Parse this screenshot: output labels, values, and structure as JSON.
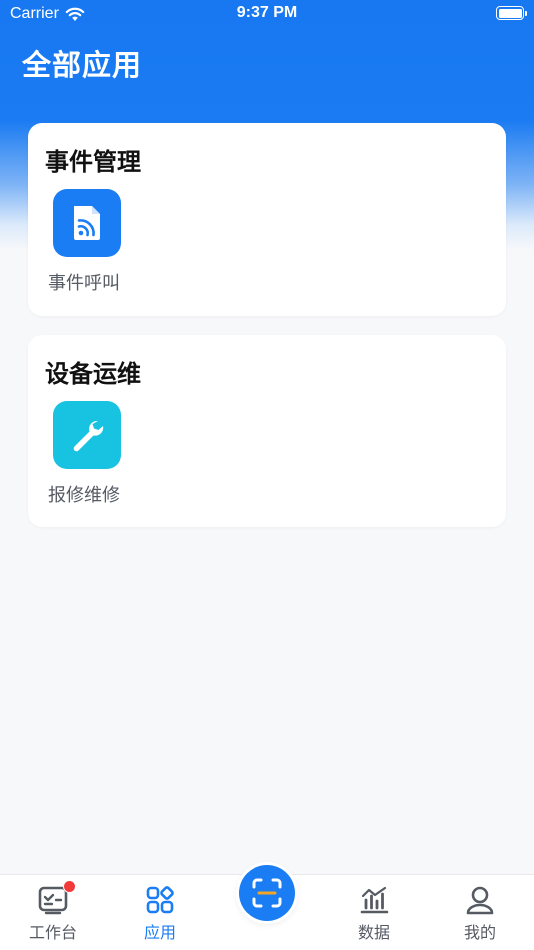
{
  "status_bar": {
    "carrier": "Carrier",
    "time": "9:37 PM",
    "wifi_icon": "wifi-icon",
    "battery_icon": "battery-full-icon",
    "battery_level": 1.0
  },
  "header": {
    "title": "全部应用"
  },
  "sections": [
    {
      "title": "事件管理",
      "apps": [
        {
          "label": "事件呼叫",
          "icon": "document-rss-icon",
          "color": "#1a7df4"
        }
      ]
    },
    {
      "title": "设备运维",
      "apps": [
        {
          "label": "报修维修",
          "icon": "wrench-icon",
          "color": "#18c3e2"
        }
      ]
    }
  ],
  "tabbar": {
    "items": [
      {
        "label": "工作台",
        "icon": "workbench-icon",
        "active": false,
        "badge": true
      },
      {
        "label": "应用",
        "icon": "apps-grid-icon",
        "active": true
      },
      {
        "label": "",
        "icon": "scan-icon",
        "center": true
      },
      {
        "label": "数据",
        "icon": "bar-chart-icon",
        "active": false
      },
      {
        "label": "我的",
        "icon": "user-icon",
        "active": false
      }
    ]
  },
  "colors": {
    "brand": "#1a7df4",
    "accent_cyan": "#18c3e2",
    "badge": "#f23a3a",
    "background": "#f7f8fa"
  }
}
